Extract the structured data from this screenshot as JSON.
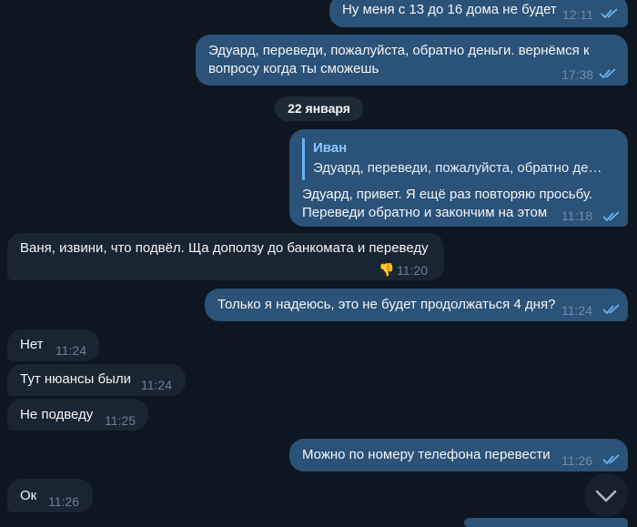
{
  "messages": [
    {
      "text": "Ну меня с 13 до 16 дома не будет",
      "time": "12:11"
    },
    {
      "line1": "Эдуард, переведи, пожалуйста, обратно деньги. вернёмся к",
      "line2": "вопросу когда ты сможешь",
      "time": "17:38"
    },
    {
      "reply_name": "Иван",
      "reply_text": "Эдуард, переведи, пожалуйста, обратно деньг...",
      "line1": "Эдуард, привет. Я ещё раз повторяю просьбу.",
      "line2": "Переведи обратно и закончим на этом",
      "time": "11:18"
    },
    {
      "text": "Ваня, извини, что подвёл. Ща доползу до банкомата и переведу",
      "reaction": "👎",
      "time": "11:20"
    },
    {
      "text": "Только я надеюсь, это не будет продолжаться 4 дня?",
      "time": "11:24"
    },
    {
      "text": "Нет",
      "time": "11:24"
    },
    {
      "text": "Тут нюансы были",
      "time": "11:24"
    },
    {
      "text": "Не подведу",
      "time": "11:25"
    },
    {
      "text": "Можно по номеру телефона перевести",
      "time": "11:26"
    },
    {
      "text": "Ок",
      "time": "11:26"
    }
  ],
  "date_separator": "22 января",
  "icons": {
    "read": "double-check-icon",
    "scroll": "chevron-down-icon",
    "reaction": "thumbs-down-icon"
  },
  "colors": {
    "background": "#0e1621",
    "outgoing": "#2b5278",
    "incoming": "#182533",
    "check": "#6ab3f3"
  }
}
